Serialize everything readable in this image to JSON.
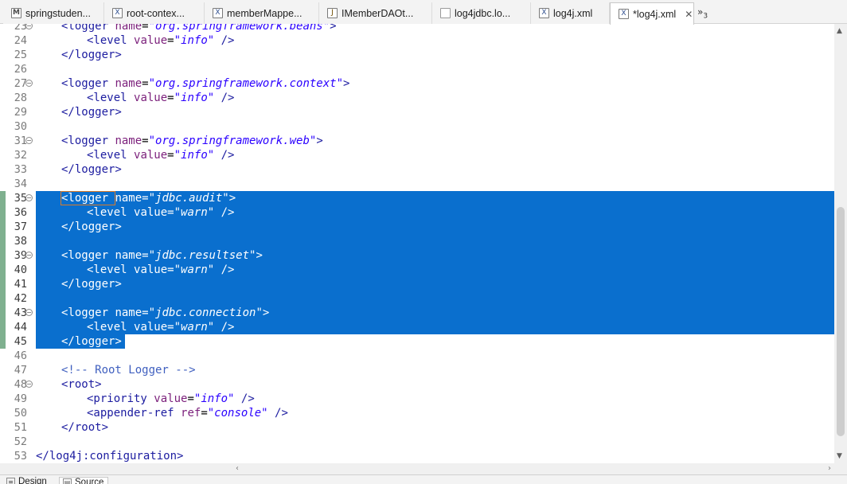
{
  "tabs": [
    {
      "label": "springstuden...",
      "icon": "maven-pom-icon",
      "glyph": "M",
      "active": false
    },
    {
      "label": "root-contex...",
      "icon": "xml-file-icon",
      "glyph": "X",
      "active": false
    },
    {
      "label": "memberMappe...",
      "icon": "xml-file-icon",
      "glyph": "X",
      "active": false
    },
    {
      "label": "IMemberDAOt...",
      "icon": "java-file-icon",
      "glyph": "J",
      "active": false
    },
    {
      "label": "log4jdbc.lo...",
      "icon": "text-file-icon",
      "glyph": "",
      "active": false
    },
    {
      "label": "log4j.xml",
      "icon": "xml-file-icon",
      "glyph": "X",
      "active": false
    },
    {
      "label": "*log4j.xml",
      "icon": "xml-file-icon",
      "glyph": "X",
      "active": true
    }
  ],
  "tab_close_glyph": "✕",
  "overflow": {
    "glyph": "»",
    "count": "3"
  },
  "editor": {
    "selection_color": "#0a6fce",
    "lines": [
      {
        "n": "23",
        "fold": true,
        "sel": false,
        "indent": 1,
        "seg": [
          [
            "tag",
            "<logger "
          ],
          [
            "attr",
            "name"
          ],
          [
            "eq",
            "="
          ],
          [
            "val",
            "\"org.springframework.beans\""
          ],
          [
            "tag",
            ">"
          ]
        ]
      },
      {
        "n": "24",
        "fold": false,
        "sel": false,
        "indent": 2,
        "seg": [
          [
            "tag",
            "<level "
          ],
          [
            "attr",
            "value"
          ],
          [
            "eq",
            "="
          ],
          [
            "val",
            "\"info\""
          ],
          [
            "tag",
            " />"
          ]
        ]
      },
      {
        "n": "25",
        "fold": false,
        "sel": false,
        "indent": 1,
        "seg": [
          [
            "tag",
            "</logger>"
          ]
        ]
      },
      {
        "n": "26",
        "fold": false,
        "sel": false,
        "indent": 0,
        "seg": []
      },
      {
        "n": "27",
        "fold": true,
        "sel": false,
        "indent": 1,
        "seg": [
          [
            "tag",
            "<logger "
          ],
          [
            "attr",
            "name"
          ],
          [
            "eq",
            "="
          ],
          [
            "val",
            "\"org.springframework.context\""
          ],
          [
            "tag",
            ">"
          ]
        ]
      },
      {
        "n": "28",
        "fold": false,
        "sel": false,
        "indent": 2,
        "seg": [
          [
            "tag",
            "<level "
          ],
          [
            "attr",
            "value"
          ],
          [
            "eq",
            "="
          ],
          [
            "val",
            "\"info\""
          ],
          [
            "tag",
            " />"
          ]
        ]
      },
      {
        "n": "29",
        "fold": false,
        "sel": false,
        "indent": 1,
        "seg": [
          [
            "tag",
            "</logger>"
          ]
        ]
      },
      {
        "n": "30",
        "fold": false,
        "sel": false,
        "indent": 0,
        "seg": []
      },
      {
        "n": "31",
        "fold": true,
        "sel": false,
        "indent": 1,
        "seg": [
          [
            "tag",
            "<logger "
          ],
          [
            "attr",
            "name"
          ],
          [
            "eq",
            "="
          ],
          [
            "val",
            "\"org.springframework.web\""
          ],
          [
            "tag",
            ">"
          ]
        ]
      },
      {
        "n": "32",
        "fold": false,
        "sel": false,
        "indent": 2,
        "seg": [
          [
            "tag",
            "<level "
          ],
          [
            "attr",
            "value"
          ],
          [
            "eq",
            "="
          ],
          [
            "val",
            "\"info\""
          ],
          [
            "tag",
            " />"
          ]
        ]
      },
      {
        "n": "33",
        "fold": false,
        "sel": false,
        "indent": 1,
        "seg": [
          [
            "tag",
            "</logger>"
          ]
        ]
      },
      {
        "n": "34",
        "fold": false,
        "sel": false,
        "indent": 0,
        "seg": []
      },
      {
        "n": "35",
        "fold": true,
        "sel": true,
        "indent": 1,
        "seg": [
          [
            "tag",
            "<logger "
          ],
          [
            "attr",
            "name"
          ],
          [
            "eq",
            "="
          ],
          [
            "val",
            "\"jdbc.audit\""
          ],
          [
            "tag",
            ">"
          ]
        ]
      },
      {
        "n": "36",
        "fold": false,
        "sel": true,
        "indent": 2,
        "seg": [
          [
            "tag",
            "<level "
          ],
          [
            "attr",
            "value"
          ],
          [
            "eq",
            "="
          ],
          [
            "val",
            "\"warn\""
          ],
          [
            "tag",
            " />"
          ]
        ]
      },
      {
        "n": "37",
        "fold": false,
        "sel": true,
        "indent": 1,
        "seg": [
          [
            "tag",
            "</logger>"
          ]
        ]
      },
      {
        "n": "38",
        "fold": false,
        "sel": true,
        "indent": 0,
        "seg": []
      },
      {
        "n": "39",
        "fold": true,
        "sel": true,
        "indent": 1,
        "seg": [
          [
            "tag",
            "<logger "
          ],
          [
            "attr",
            "name"
          ],
          [
            "eq",
            "="
          ],
          [
            "val",
            "\"jdbc.resultset\""
          ],
          [
            "tag",
            ">"
          ]
        ]
      },
      {
        "n": "40",
        "fold": false,
        "sel": true,
        "indent": 2,
        "seg": [
          [
            "tag",
            "<level "
          ],
          [
            "attr",
            "value"
          ],
          [
            "eq",
            "="
          ],
          [
            "val",
            "\"warn\""
          ],
          [
            "tag",
            " />"
          ]
        ]
      },
      {
        "n": "41",
        "fold": false,
        "sel": true,
        "indent": 1,
        "seg": [
          [
            "tag",
            "</logger>"
          ]
        ]
      },
      {
        "n": "42",
        "fold": false,
        "sel": true,
        "indent": 0,
        "seg": []
      },
      {
        "n": "43",
        "fold": true,
        "sel": true,
        "indent": 1,
        "seg": [
          [
            "tag",
            "<logger "
          ],
          [
            "attr",
            "name"
          ],
          [
            "eq",
            "="
          ],
          [
            "val",
            "\"jdbc.connection\""
          ],
          [
            "tag",
            ">"
          ]
        ]
      },
      {
        "n": "44",
        "fold": false,
        "sel": true,
        "indent": 2,
        "seg": [
          [
            "tag",
            "<level "
          ],
          [
            "attr",
            "value"
          ],
          [
            "eq",
            "="
          ],
          [
            "val",
            "\"warn\""
          ],
          [
            "tag",
            " />"
          ]
        ]
      },
      {
        "n": "45",
        "fold": false,
        "sel": true,
        "indent": 1,
        "seg": [
          [
            "tag",
            "</logger>"
          ]
        ]
      },
      {
        "n": "46",
        "fold": false,
        "sel": false,
        "indent": 0,
        "seg": []
      },
      {
        "n": "47",
        "fold": false,
        "sel": false,
        "indent": 1,
        "seg": [
          [
            "cmt",
            "<!-- Root Logger -->"
          ]
        ]
      },
      {
        "n": "48",
        "fold": true,
        "sel": false,
        "indent": 1,
        "seg": [
          [
            "tag",
            "<root>"
          ]
        ]
      },
      {
        "n": "49",
        "fold": false,
        "sel": false,
        "indent": 2,
        "seg": [
          [
            "tag",
            "<priority "
          ],
          [
            "attr",
            "value"
          ],
          [
            "eq",
            "="
          ],
          [
            "val",
            "\"info\""
          ],
          [
            "tag",
            " />"
          ]
        ]
      },
      {
        "n": "50",
        "fold": false,
        "sel": false,
        "indent": 2,
        "seg": [
          [
            "tag",
            "<appender-ref "
          ],
          [
            "attr",
            "ref"
          ],
          [
            "eq",
            "="
          ],
          [
            "val",
            "\"console\""
          ],
          [
            "tag",
            " />"
          ]
        ]
      },
      {
        "n": "51",
        "fold": false,
        "sel": false,
        "indent": 1,
        "seg": [
          [
            "tag",
            "</root>"
          ]
        ]
      },
      {
        "n": "52",
        "fold": false,
        "sel": false,
        "indent": 0,
        "seg": []
      },
      {
        "n": "53",
        "fold": false,
        "sel": false,
        "indent": 0,
        "seg": [
          [
            "tag",
            "</log4j:configuration>"
          ]
        ]
      }
    ]
  },
  "bottom_tabs": [
    {
      "label": "Design",
      "icon": "design-icon",
      "active": false
    },
    {
      "label": "Source",
      "icon": "source-icon",
      "active": true
    }
  ]
}
